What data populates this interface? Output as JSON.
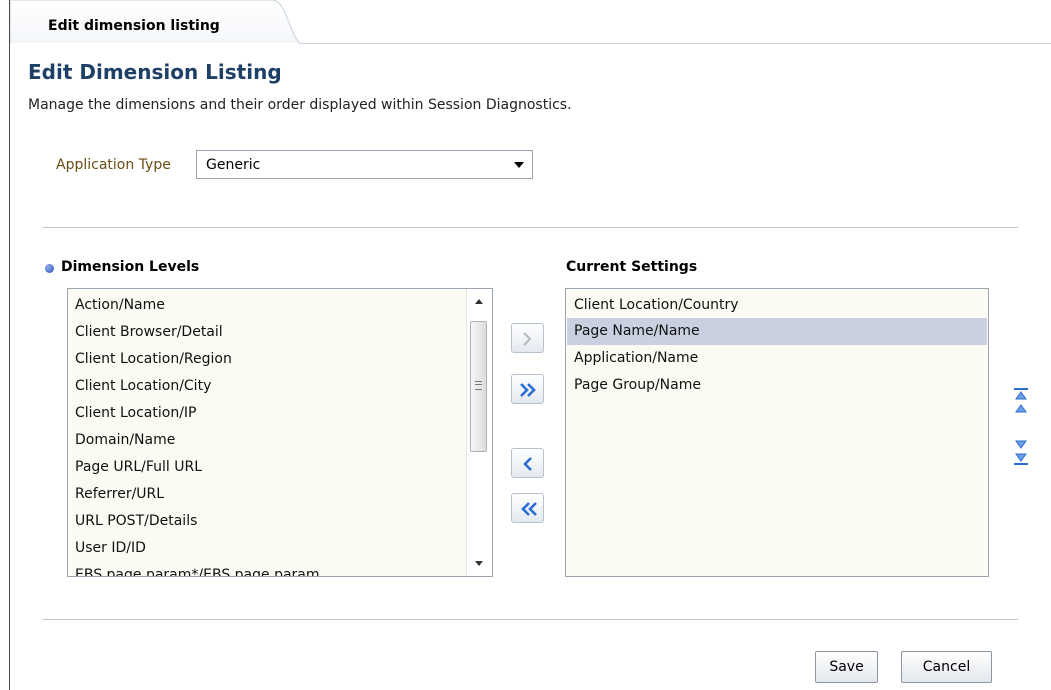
{
  "tab": {
    "label": "Edit dimension listing"
  },
  "page": {
    "title": "Edit Dimension Listing",
    "description": "Manage the dimensions and their order displayed within Session Diagnostics."
  },
  "application_type": {
    "label": "Application Type",
    "value": "Generic"
  },
  "dimension_levels": {
    "heading": "Dimension Levels",
    "items": [
      "Action/Name",
      "Client Browser/Detail",
      "Client Location/Region",
      "Client Location/City",
      "Client Location/IP",
      "Domain/Name",
      "Page URL/Full URL",
      "Referrer/URL",
      "URL POST/Details",
      "User ID/ID",
      "EBS page param*/EBS page param"
    ]
  },
  "current_settings": {
    "heading": "Current Settings",
    "items": [
      "Client Location/Country",
      "Page Name/Name",
      "Application/Name",
      "Page Group/Name"
    ],
    "selected": "Page Name/Name"
  },
  "buttons": {
    "save": "Save",
    "cancel": "Cancel"
  },
  "icons": {
    "move": "move-right-icon",
    "move_all": "move-all-right-icon",
    "remove": "move-left-icon",
    "remove_all": "move-all-left-icon",
    "top": "move-to-top-icon",
    "up": "move-up-icon",
    "down": "move-down-icon",
    "bottom": "move-to-bottom-icon"
  },
  "colors": {
    "title": "#1e3f66",
    "label": "#6b4e16",
    "list_background": "#fbfaf3",
    "selection": "#c9d1e0",
    "arrow_accent": "#2b6dd1"
  }
}
